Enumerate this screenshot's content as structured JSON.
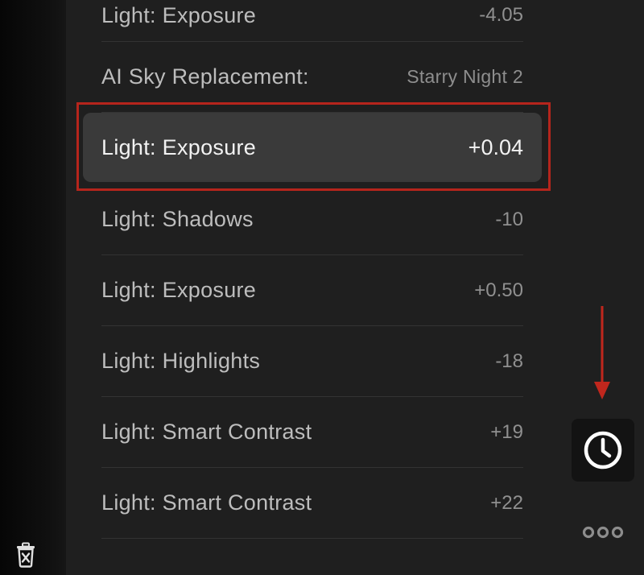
{
  "history": {
    "top_partial": {
      "label": "Light: Exposure",
      "value": "-4.05"
    },
    "sky": {
      "label": "AI Sky Replacement:",
      "value": "Starry Night 2"
    },
    "selected": {
      "label": "Light: Exposure",
      "value": "+0.04"
    },
    "items": [
      {
        "label": "Light: Shadows",
        "value": "-10"
      },
      {
        "label": "Light: Exposure",
        "value": "+0.50"
      },
      {
        "label": "Light: Highlights",
        "value": "-18"
      },
      {
        "label": "Light: Smart Contrast",
        "value": "+19"
      },
      {
        "label": "Light: Smart Contrast",
        "value": "+22"
      }
    ]
  },
  "icons": {
    "trash": "trash-icon",
    "history": "clock-icon",
    "more": "more-horizontal-icon",
    "annotation": "arrow-down-icon"
  },
  "colors": {
    "panel_background": "#1f1f1f",
    "selected_row": "#3a3a3a",
    "highlight_border": "#b5251c",
    "annotation_arrow": "#c0271d"
  }
}
